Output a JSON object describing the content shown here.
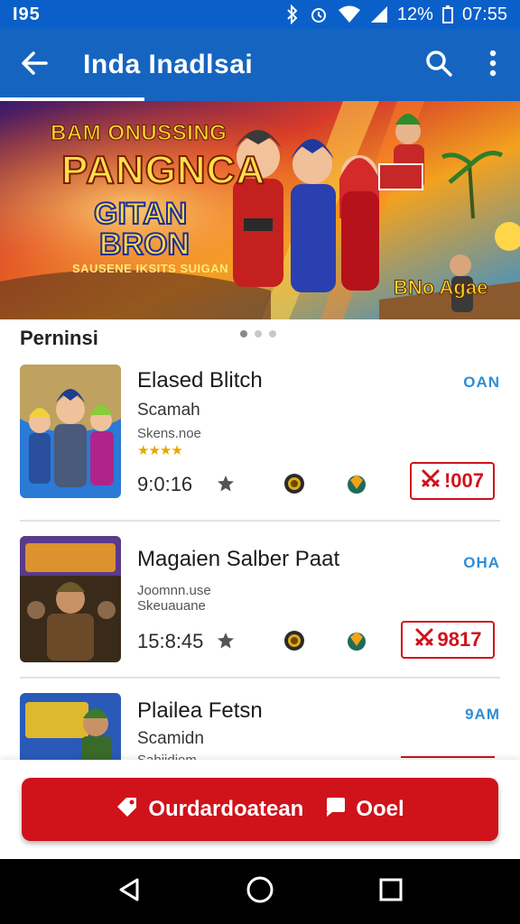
{
  "status_bar": {
    "left_text": "I95",
    "battery": "12%",
    "time": "07:55"
  },
  "app_bar": {
    "title": "Inda Inadlsai"
  },
  "banner": {
    "line1": "BAM ONUSSING",
    "line2": "PANGNCA",
    "line3": "GITAN",
    "line4": "BRON",
    "tagline": "SAUSENE IKSITS SUIGAN",
    "corner_text": "BNo Agae"
  },
  "section": {
    "title": "Perninsi"
  },
  "items": [
    {
      "title": "Elased Blitch",
      "subtitle": "Scamah",
      "meta": "Skens.noe",
      "rating": "★★★★",
      "time": "9:0:16",
      "badge": "OAN",
      "price": "!007"
    },
    {
      "title": "Magaien Salber Paat",
      "subtitle": "",
      "meta": "Joomnn.use\nSkeuauane",
      "rating": "",
      "time": "15:8:45",
      "badge": "OHA",
      "price": "9817"
    },
    {
      "title": "Plailea Fetsn",
      "subtitle": "Scamidn",
      "meta": "Sabiidiem",
      "rating": "",
      "time": "",
      "badge": "9AM",
      "price": ""
    }
  ],
  "cta": {
    "label_primary": "Ourdardoatean",
    "label_secondary": "Ooel"
  },
  "colors": {
    "primary": "#1565c0",
    "status": "#0b5fc9",
    "accent_red": "#d0121b",
    "badge_blue": "#2f8dd6"
  },
  "icons": {
    "back": "arrow-left-icon",
    "search": "search-icon",
    "more": "more-vert-icon",
    "tag": "tag-icon",
    "card": "card-icon",
    "nav_back": "triangle-back-icon",
    "nav_home": "circle-home-icon",
    "nav_recents": "square-recents-icon"
  }
}
